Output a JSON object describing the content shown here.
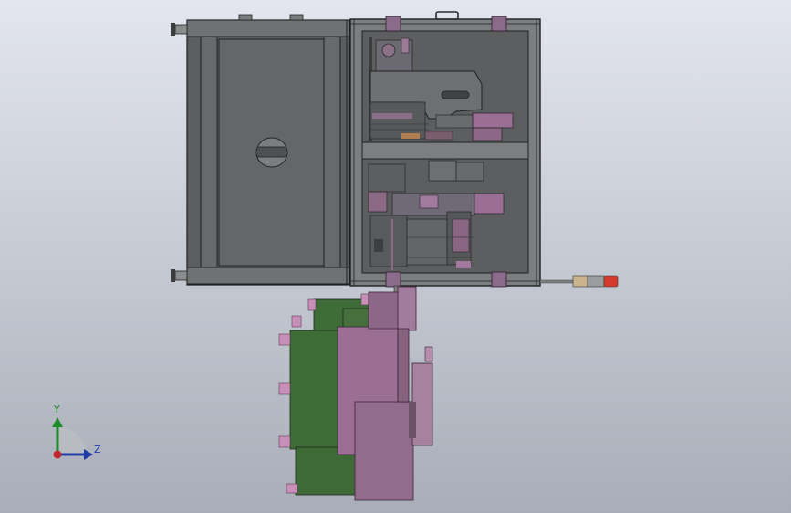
{
  "scene": {
    "colors": {
      "background_top": "#e3e6ee",
      "background_bottom": "#a9adb7",
      "frame": "#6e7072",
      "frame_dark": "#2c2d2f",
      "panel": "#5f6163",
      "bracket": "#8c6e8a",
      "purple_part": "#9a6f93",
      "green_part": "#3f6d38",
      "light_indicator_red": "#d43a2b",
      "light_indicator_tan": "#c9b48f"
    }
  },
  "triad": {
    "y_label": "Y",
    "z_label": "Z",
    "y_color": "#1e8c2c",
    "z_color": "#1f3aa8",
    "x_color": "#c0282d"
  }
}
